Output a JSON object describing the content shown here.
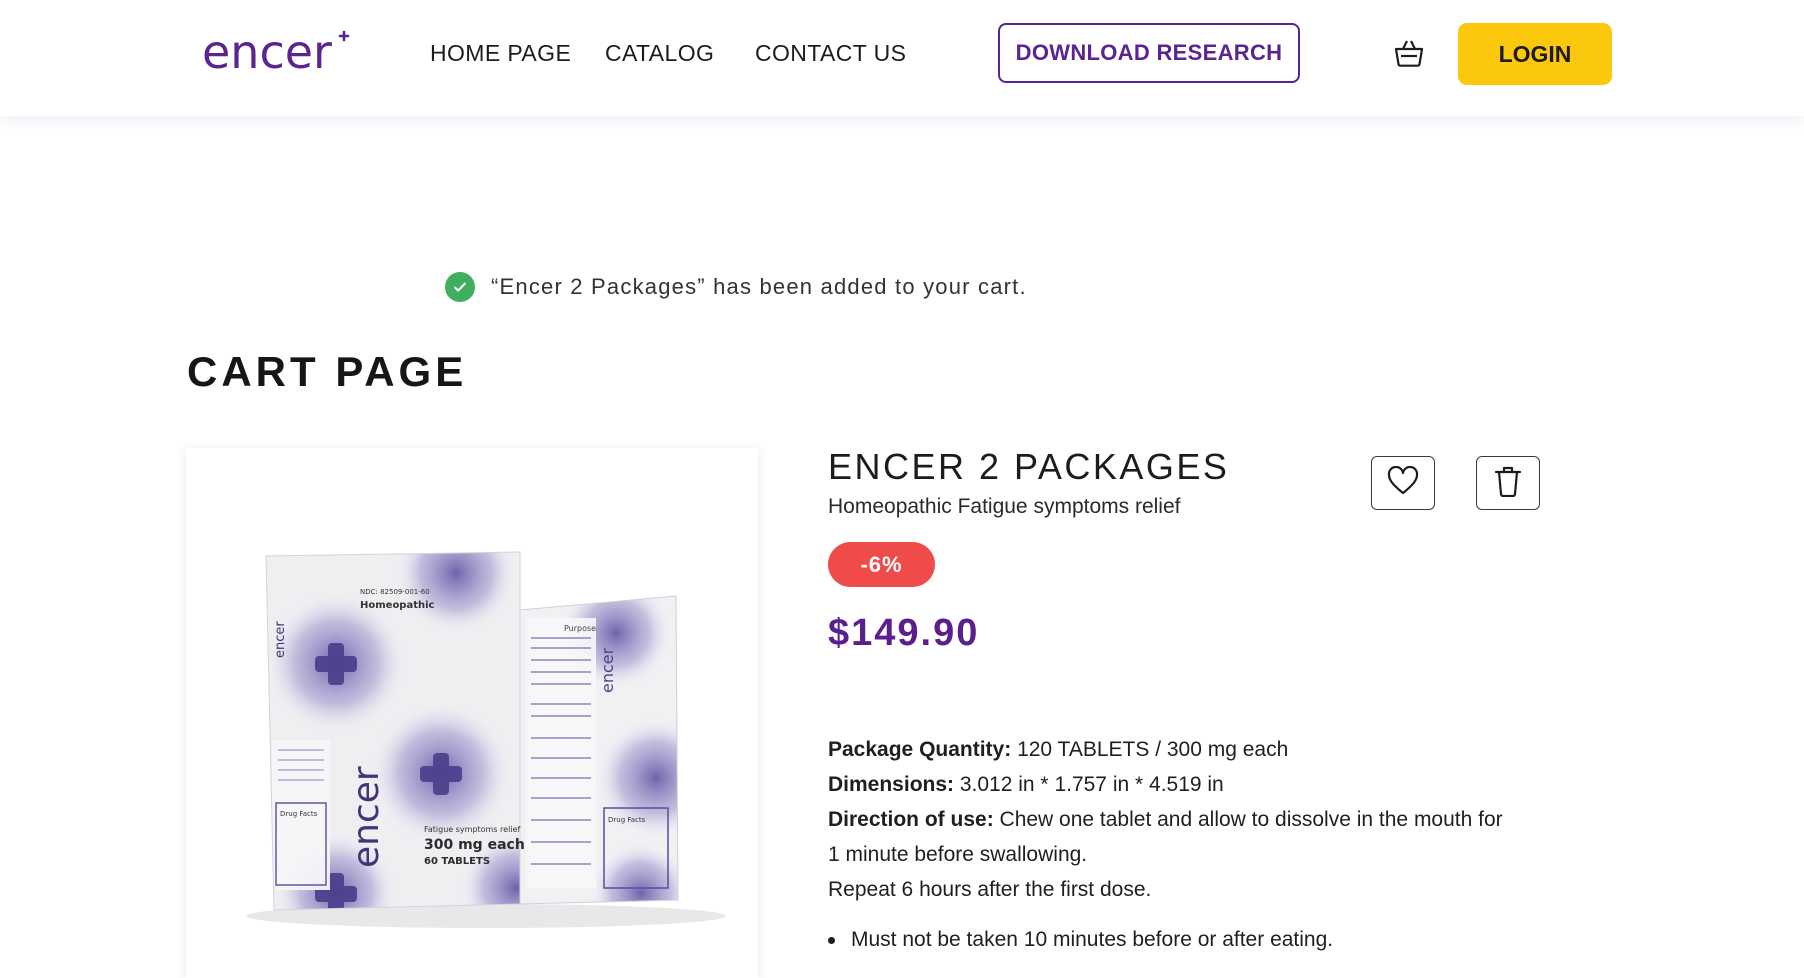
{
  "brand": {
    "name": "encer"
  },
  "nav": {
    "items": [
      "HOME PAGE",
      "CATALOG",
      "CONTACT US"
    ],
    "download_label": "DOWNLOAD RESEARCH",
    "login_label": "LOGIN"
  },
  "notice": {
    "text": "“Encer 2 Packages” has been added to your cart."
  },
  "page": {
    "title": "CART PAGE"
  },
  "product": {
    "title": "ENCER 2 PACKAGES",
    "subtitle": "Homeopathic Fatigue symptoms relief",
    "discount": "-6%",
    "price": "$149.90",
    "image_text": {
      "ndc": "NDC: 82509-001-60",
      "homeopathic": "Homeopathic",
      "logo": "encer",
      "relief": "Fatigue symptoms relief",
      "dose": "300 mg each",
      "count": "60 TABLETS",
      "purpose": "Purpose",
      "drug_facts": "Drug Facts"
    },
    "details": {
      "qty_label": "Package Quantity:",
      "qty_value": " 120 TABLETS / 300 mg each",
      "dim_label": "Dimensions:",
      "dim_value": " 3.012 in * 1.757 in * 4.519 in",
      "dir_label": "Direction of use:",
      "dir_value": " Chew one tablet and allow to dissolve in the mouth for",
      "dir_value_2": "1 minute before swallowing.",
      "repeat": "Repeat 6 hours after the first dose.",
      "bullet_1": "Must not be taken 10 minutes before or after eating."
    }
  },
  "colors": {
    "brand_purple": "#5a2491",
    "price_purple": "#5a1e8e",
    "login_yellow": "#fcc80d",
    "discount_red": "#f04b4b",
    "success_green": "#3fae5e"
  },
  "icons": {
    "cart": "shopping-basket-icon",
    "check": "check-circle-icon",
    "wishlist": "heart-icon",
    "remove": "trash-icon"
  }
}
